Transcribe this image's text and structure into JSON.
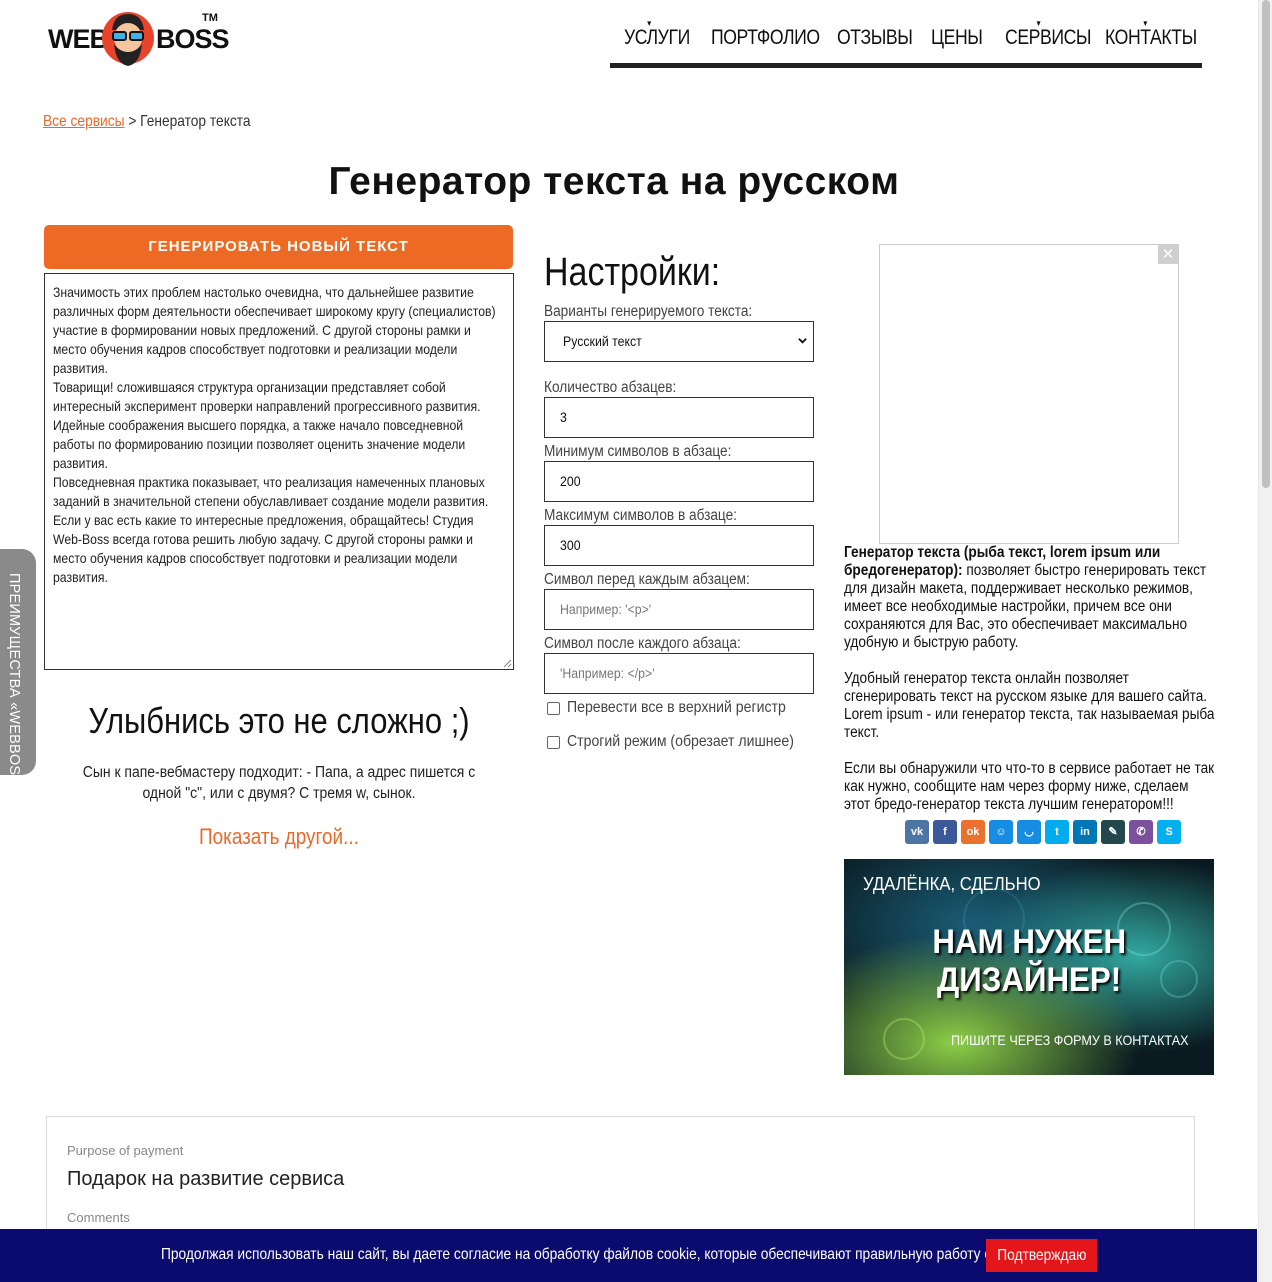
{
  "header": {
    "logo": {
      "word_left": "WEB",
      "word_right": "BOSS",
      "tm": "TM"
    },
    "nav": [
      {
        "label": "УСЛУГИ",
        "has_dropdown": true
      },
      {
        "label": "ПОРТФОЛИО",
        "has_dropdown": false
      },
      {
        "label": "ОТЗЫВЫ",
        "has_dropdown": false
      },
      {
        "label": "ЦЕНЫ",
        "has_dropdown": false
      },
      {
        "label": "СЕРВИСЫ",
        "has_dropdown": true
      },
      {
        "label": "КОНТАКТЫ",
        "has_dropdown": true
      }
    ]
  },
  "breadcrumb": {
    "link": "Все сервисы",
    "separator": ">",
    "current": "Генератор текста"
  },
  "page_title": "Генератор текста на русском",
  "generator": {
    "button_label": "ГЕНЕРИРОВАТЬ НОВЫЙ ТЕКСТ",
    "paragraphs": [
      "Значимость этих проблем настолько очевидна, что дальнейшее развитие различных форм деятельности обеспечивает широкому кругу (специалистов) участие в формировании новых предложений. С другой стороны рамки и место обучения кадров способствует подготовки и реализации модели развития.",
      "Товарищи! сложившаяся структура организации представляет собой интересный эксперимент проверки направлений прогрессивного развития. Идейные соображения высшего порядка, а также начало повседневной работы по формированию позиции позволяет оценить значение модели развития.",
      "Повседневная практика показывает, что реализация намеченных плановых заданий в значительной степени обуславливает создание модели развития. Если у вас есть какие то интересные предложения, обращайтесь! Студия Web-Boss всегда готова решить любую задачу. С другой стороны рамки и место обучения кадров способствует подготовки и реализации модели развития."
    ]
  },
  "joke": {
    "title": "Улыбнись это не сложно ;)",
    "text": "Сын к папе-вебмастеру подходит: - Папа, а адрес пишется с одной \"с\", или с двумя? С тремя w, сынок.",
    "more_link": "Показать другой..."
  },
  "side_tab": {
    "label": "ПРЕИМУЩЕСТВА «WEBBOSS»"
  },
  "settings": {
    "title": "Настройки:",
    "variant": {
      "label": "Варианты генерируемого текста:",
      "value": "Русский текст"
    },
    "paragraphs_count": {
      "label": "Количество абзацев:",
      "value": "3"
    },
    "min_chars": {
      "label": "Минимум символов в абзаце:",
      "value": "200"
    },
    "max_chars": {
      "label": "Максимум символов в абзаце:",
      "value": "300"
    },
    "prefix": {
      "label": "Символ перед каждым абзацем:",
      "placeholder": "Например: '<p>'"
    },
    "suffix": {
      "label": "Символ после каждого абзаца:",
      "placeholder": "'Например: </p>'"
    },
    "uppercase": {
      "label": "Перевести все в верхний регистр",
      "checked": false
    },
    "strict": {
      "label": "Строгий режим (обрезает лишнее)",
      "checked": false
    }
  },
  "ad": {
    "close": "✕"
  },
  "description": {
    "lead_bold": "Генератор текста (рыба текст, lorem ipsum или бредогенератор):",
    "lead_rest": " позволяет быстро генерировать текст для дизайн макета, поддерживает несколько режимов, имеет все необходимые настройки, причем все они сохраняются для Вас, это обеспечивает максимально удобную и быструю работу.",
    "p2": "Удобный генератор текста онлайн позволяет сгенерировать текст на русском языке для вашего сайта. Lorem ipsum - или генератор текста, так называемая рыба текст.",
    "p3": "Если вы обнаружили что что-то в сервисе работает не так как нужно, сообщите нам через форму ниже, сделаем этот бредо-генератор текста лучшим генератором!!!"
  },
  "share": [
    {
      "name": "vk",
      "glyph": "vk",
      "color": "#4c75a3"
    },
    {
      "name": "facebook",
      "glyph": "f",
      "color": "#3b5998"
    },
    {
      "name": "odnoklassniki",
      "glyph": "ok",
      "color": "#eb722e"
    },
    {
      "name": "moimir",
      "glyph": "☺",
      "color": "#168de2"
    },
    {
      "name": "mail",
      "glyph": "◡",
      "color": "#168de2"
    },
    {
      "name": "twitter",
      "glyph": "t",
      "color": "#00aced"
    },
    {
      "name": "linkedin",
      "glyph": "in",
      "color": "#0077b5"
    },
    {
      "name": "evernote",
      "glyph": "✎",
      "color": "#24474e"
    },
    {
      "name": "viber",
      "glyph": "✆",
      "color": "#7b519d"
    },
    {
      "name": "skype",
      "glyph": "S",
      "color": "#00aff0"
    }
  ],
  "banner": {
    "top": "УДАЛЁНКА, СДЕЛЬНО",
    "line1": "НАМ НУЖЕН",
    "line2": "ДИЗАЙНЕР!",
    "bottom": "ПИШИТЕ ЧЕРЕЗ ФОРМУ В КОНТАКТАХ"
  },
  "payment": {
    "purpose_label": "Purpose of payment",
    "purpose_value": "Подарок на развитие сервиса",
    "comments_label": "Comments"
  },
  "cookie": {
    "text": "Продолжая использовать наш сайт, вы даете согласие на обработку файлов cookie, которые обеспечивают правильную работу сайта.",
    "button": "Подтверждаю"
  },
  "colors": {
    "accent": "#ec6a24",
    "cookie_bg": "#0b0a6e",
    "cookie_btn": "#e3171b"
  }
}
